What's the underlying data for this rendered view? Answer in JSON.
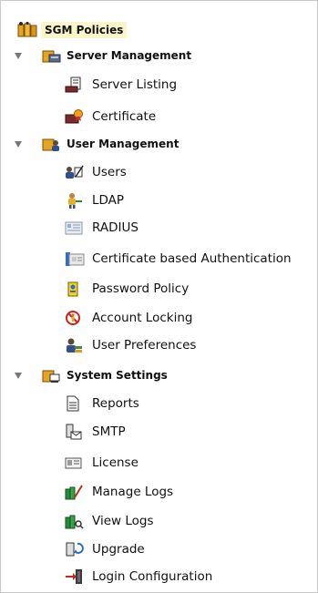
{
  "tree": {
    "root": {
      "label": "SGM Policies",
      "icon": "folder-tree-icon"
    },
    "groups": [
      {
        "label": "Server Management",
        "icon": "server-management-icon",
        "items": [
          {
            "label": "Server Listing",
            "icon": "server-listing-icon"
          },
          {
            "label": "Certificate",
            "icon": "certificate-icon"
          }
        ]
      },
      {
        "label": "User Management",
        "icon": "user-management-icon",
        "items": [
          {
            "label": "Users",
            "icon": "users-icon"
          },
          {
            "label": "LDAP",
            "icon": "ldap-icon"
          },
          {
            "label": "RADIUS",
            "icon": "radius-icon"
          },
          {
            "label": "Certificate based Authentication",
            "icon": "certificate-auth-icon"
          },
          {
            "label": "Password Policy",
            "icon": "password-policy-icon"
          },
          {
            "label": "Account Locking",
            "icon": "account-locking-icon"
          },
          {
            "label": "User Preferences",
            "icon": "user-preferences-icon"
          }
        ]
      },
      {
        "label": "System Settings",
        "icon": "system-settings-icon",
        "items": [
          {
            "label": "Reports",
            "icon": "reports-icon"
          },
          {
            "label": "SMTP",
            "icon": "smtp-icon"
          },
          {
            "label": "License",
            "icon": "license-icon"
          },
          {
            "label": "Manage Logs",
            "icon": "manage-logs-icon"
          },
          {
            "label": "View Logs",
            "icon": "view-logs-icon"
          },
          {
            "label": "Upgrade",
            "icon": "upgrade-icon"
          },
          {
            "label": "Login Configuration",
            "icon": "login-configuration-icon"
          }
        ]
      }
    ]
  }
}
